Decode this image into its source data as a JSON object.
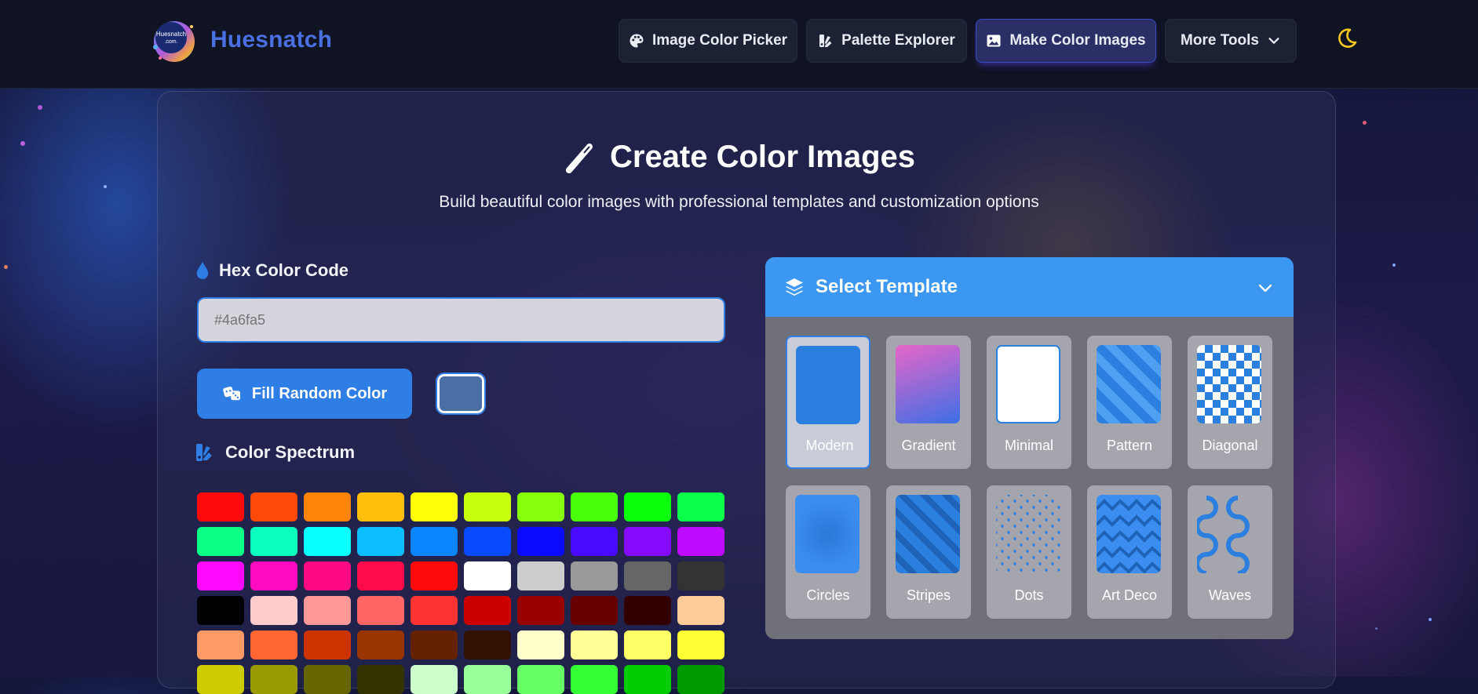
{
  "header": {
    "logo_text": "Huesnatch .com.",
    "brand": "Huesnatch",
    "nav": [
      {
        "label": "Image Color Picker",
        "icon": "palette-icon",
        "active": false
      },
      {
        "label": "Palette Explorer",
        "icon": "swatchbook-icon",
        "active": false
      },
      {
        "label": "Make Color Images",
        "icon": "image-icon",
        "active": true
      },
      {
        "label": "More Tools",
        "icon": "chevron-down-icon",
        "active": false
      }
    ],
    "theme_toggle_icon": "moon-icon"
  },
  "main": {
    "title": "Create Color Images",
    "subtitle": "Build beautiful color images with professional templates and customization options",
    "hex_label": "Hex Color Code",
    "hex_placeholder": "#4a6fa5",
    "random_button": "Fill Random Color",
    "preview_color": "#4a6fa5",
    "spectrum_label": "Color Spectrum",
    "spectrum_colors": [
      "#ff0a0a",
      "#ff4a0a",
      "#ff850a",
      "#ffbe0a",
      "#ffff0a",
      "#c8ff0a",
      "#88ff0a",
      "#4aff0a",
      "#0aff0a",
      "#0aff4a",
      "#0aff85",
      "#0affbe",
      "#0affff",
      "#0abeff",
      "#0a85ff",
      "#0a4aff",
      "#0a0aff",
      "#4a0aff",
      "#850aff",
      "#be0aff",
      "#ff0aff",
      "#ff0abe",
      "#ff0a85",
      "#ff0a4a",
      "#ff0a0a",
      "#ffffff",
      "#cccccc",
      "#999999",
      "#666666",
      "#333333",
      "#000000",
      "#ffcccc",
      "#ff9999",
      "#ff6666",
      "#ff3333",
      "#cc0000",
      "#990000",
      "#660000",
      "#330000",
      "#ffcc99",
      "#ff9966",
      "#ff6633",
      "#cc3300",
      "#993300",
      "#662200",
      "#331100",
      "#ffffcc",
      "#ffff99",
      "#ffff66",
      "#ffff33",
      "#cccc00",
      "#999900",
      "#666600",
      "#333300",
      "#ccffcc",
      "#99ff99",
      "#66ff66",
      "#33ff33",
      "#00cc00",
      "#009900"
    ]
  },
  "templates": {
    "title": "Select Template",
    "items": [
      {
        "name": "Modern",
        "selected": true
      },
      {
        "name": "Gradient",
        "selected": false
      },
      {
        "name": "Minimal",
        "selected": false
      },
      {
        "name": "Pattern",
        "selected": false
      },
      {
        "name": "Diagonal",
        "selected": false
      },
      {
        "name": "Circles",
        "selected": false
      },
      {
        "name": "Stripes",
        "selected": false
      },
      {
        "name": "Dots",
        "selected": false
      },
      {
        "name": "Art Deco",
        "selected": false
      },
      {
        "name": "Waves",
        "selected": false
      }
    ],
    "accent": "#3b97f2"
  }
}
